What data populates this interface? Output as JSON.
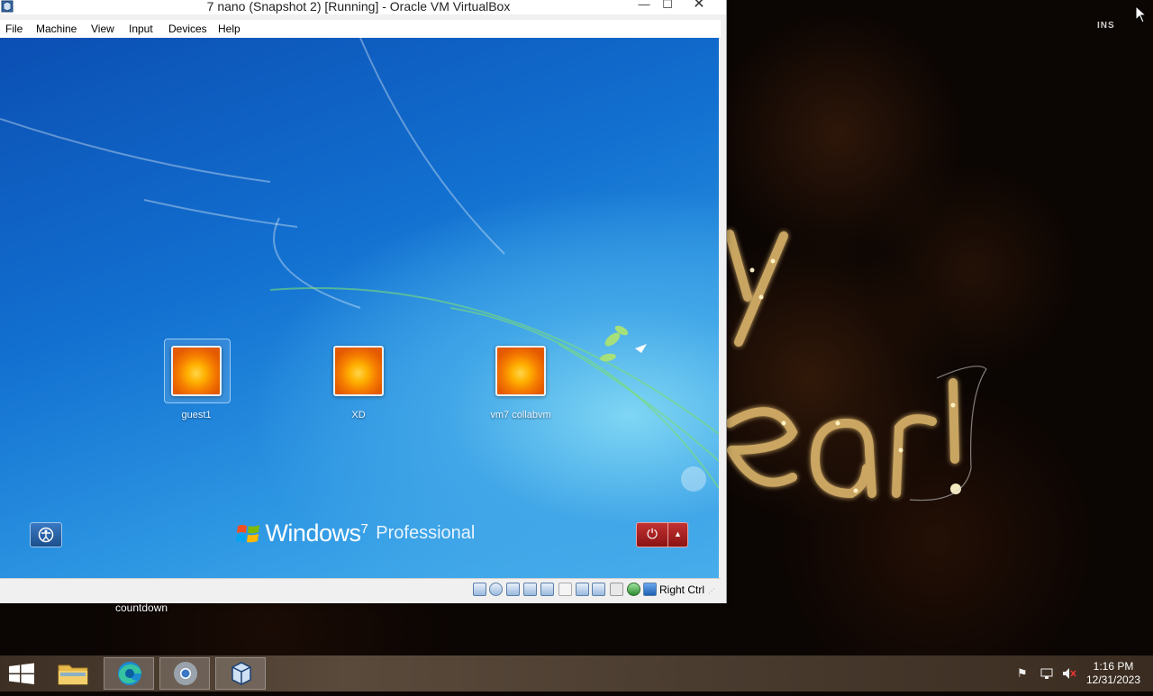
{
  "window": {
    "title": "7 nano (Snapshot 2) [Running] - Oracle VM VirtualBox",
    "menu": [
      "File",
      "Machine",
      "View",
      "Input",
      "Devices",
      "Help"
    ],
    "controls": {
      "minimize": "—",
      "maximize": "☐",
      "close": "✕"
    }
  },
  "guest": {
    "users": [
      {
        "name": "guest1",
        "selected": true
      },
      {
        "name": "XD",
        "selected": false
      },
      {
        "name": "vm7 collabvm",
        "selected": false
      }
    ],
    "brand": {
      "word": "Windows",
      "version": "7",
      "edition": "Professional"
    },
    "buttons": {
      "ease_of_access": "ease-of-access-icon",
      "power": "⏻",
      "power_options": "▲"
    }
  },
  "statusbar": {
    "host_key": "Right Ctrl",
    "icons": [
      "hard-disk-icon",
      "optical-drive-icon",
      "audio-icon",
      "network-icon",
      "usb-icon",
      "shared-folders-icon",
      "display-icon",
      "recording-icon",
      "cpu-icon",
      "mouse-integration-icon",
      "keyboard-icon"
    ]
  },
  "desktop": {
    "label": "countdown",
    "corner_logo": "INS"
  },
  "taskbar": {
    "apps": [
      "file-explorer",
      "microsoft-edge",
      "chrome",
      "virtualbox"
    ],
    "clock": {
      "time": "1:16 PM",
      "date": "12/31/2023"
    },
    "tray": [
      "action-center-flag-icon",
      "network-icon",
      "volume-muted-icon"
    ]
  },
  "colors": {
    "taskbar_accent": "#5a4a3c",
    "guest_blue": "#1270d0",
    "power_red": "#b12222"
  }
}
